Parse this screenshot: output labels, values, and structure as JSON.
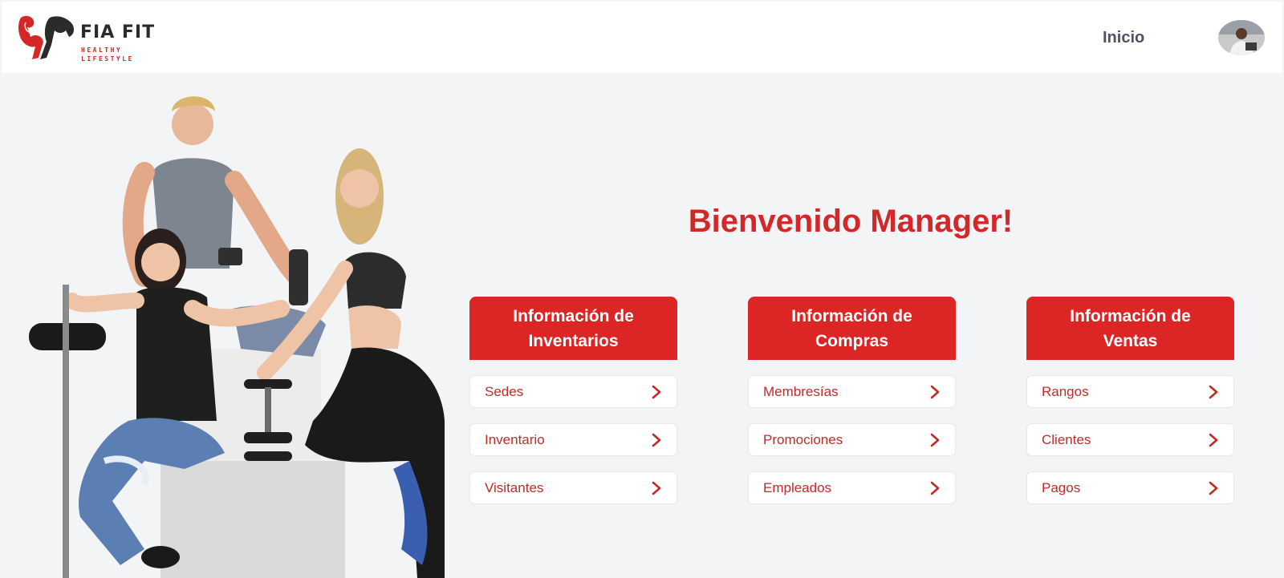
{
  "brand": {
    "name": "FIA FIT",
    "tagline_line1": "HEALTHY",
    "tagline_line2": "LIFESTYLE"
  },
  "nav": {
    "home_label": "Inicio"
  },
  "welcome": "Bienvenido Manager!",
  "sections": [
    {
      "title_line1": "Información de",
      "title_line2": "Inventarios",
      "links": [
        "Sedes",
        "Inventario",
        "Visitantes"
      ]
    },
    {
      "title_line1": "Información de",
      "title_line2": "Compras",
      "links": [
        "Membresías",
        "Promociones",
        "Empleados"
      ]
    },
    {
      "title_line1": "Información de",
      "title_line2": "Ventas",
      "links": [
        "Rangos",
        "Clientes",
        "Pagos"
      ]
    }
  ],
  "icons": {
    "link_arrow": "chevron-right-icon",
    "logo": "flexing-arm-icon"
  },
  "colors": {
    "accent": "#dc2626",
    "accent_text": "#c62828",
    "background": "#f3f4f6",
    "nav_text": "#4b5260"
  }
}
